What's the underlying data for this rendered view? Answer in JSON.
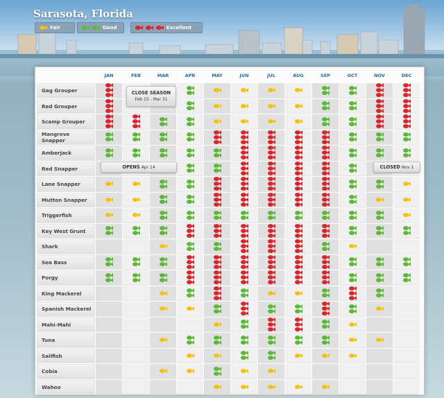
{
  "header": {
    "title": "Sarasota, Florida"
  },
  "legend": [
    {
      "label": "Fair",
      "level": "fair",
      "count": 1
    },
    {
      "label": "Good",
      "level": "good",
      "count": 2
    },
    {
      "label": "Excellent",
      "level": "excellent",
      "count": 3
    }
  ],
  "colors": {
    "fair": "#f4c20d",
    "good": "#5cb835",
    "excellent": "#d8262b",
    "month_header": "#2b6a9a"
  },
  "months": [
    "JAN",
    "FEB",
    "MAR",
    "APR",
    "MAY",
    "JUN",
    "JUL",
    "AUG",
    "SEP",
    "OCT",
    "NOV",
    "DEC"
  ],
  "species": [
    {
      "name": "Gag Grouper",
      "ratings": [
        "excellent",
        "closed",
        "closed",
        "good",
        "fair",
        "fair",
        "fair",
        "fair",
        "good",
        "good",
        "excellent",
        "excellent"
      ]
    },
    {
      "name": "Red Grouper",
      "ratings": [
        "excellent",
        "closed",
        "closed",
        "good",
        "fair",
        "fair",
        "fair",
        "fair",
        "good",
        "good",
        "excellent",
        "excellent"
      ]
    },
    {
      "name": "Scamp Grouper",
      "ratings": [
        "excellent",
        "excellent",
        "good",
        "good",
        "fair",
        "fair",
        "fair",
        "fair",
        "good",
        "good",
        "excellent",
        "excellent"
      ]
    },
    {
      "name": "Mangrove Snapper",
      "ratings": [
        "good",
        "good",
        "good",
        "good",
        "excellent",
        "excellent",
        "excellent",
        "excellent",
        "excellent",
        "good",
        "good",
        "good"
      ]
    },
    {
      "name": "Amberjack",
      "ratings": [
        "good",
        "good",
        "good",
        "good",
        "good",
        "excellent",
        "excellent",
        "excellent",
        "excellent",
        "good",
        "good",
        "good"
      ]
    },
    {
      "name": "Red Snapper",
      "ratings": [
        "closed",
        "closed",
        "closed",
        "good",
        "good",
        "excellent",
        "excellent",
        "excellent",
        "excellent",
        "good",
        "closed",
        "closed"
      ]
    },
    {
      "name": "Lane Snapper",
      "ratings": [
        "fair",
        "fair",
        "good",
        "good",
        "excellent",
        "excellent",
        "excellent",
        "excellent",
        "excellent",
        "good",
        "good",
        "fair"
      ]
    },
    {
      "name": "Mutton Snapper",
      "ratings": [
        "fair",
        "fair",
        "good",
        "good",
        "excellent",
        "excellent",
        "excellent",
        "excellent",
        "excellent",
        "good",
        "fair",
        "fair"
      ]
    },
    {
      "name": "Triggerfish",
      "ratings": [
        "fair",
        "fair",
        "good",
        "good",
        "good",
        "good",
        "good",
        "good",
        "good",
        "good",
        "good",
        "fair"
      ]
    },
    {
      "name": "Key West Grunt",
      "ratings": [
        "good",
        "good",
        "good",
        "excellent",
        "excellent",
        "excellent",
        "excellent",
        "excellent",
        "excellent",
        "good",
        "good",
        "good"
      ]
    },
    {
      "name": "Shark",
      "ratings": [
        "",
        "",
        "fair",
        "good",
        "good",
        "excellent",
        "excellent",
        "excellent",
        "good",
        "fair",
        "",
        ""
      ]
    },
    {
      "name": "Sea Bass",
      "ratings": [
        "good",
        "good",
        "good",
        "excellent",
        "excellent",
        "excellent",
        "excellent",
        "excellent",
        "excellent",
        "good",
        "good",
        "good"
      ]
    },
    {
      "name": "Porgy",
      "ratings": [
        "good",
        "good",
        "good",
        "excellent",
        "excellent",
        "excellent",
        "excellent",
        "excellent",
        "excellent",
        "good",
        "good",
        "good"
      ]
    },
    {
      "name": "King Mackerel",
      "ratings": [
        "",
        "",
        "fair",
        "good",
        "excellent",
        "good",
        "fair",
        "fair",
        "good",
        "excellent",
        "good",
        ""
      ]
    },
    {
      "name": "Spanish Mackerel",
      "ratings": [
        "",
        "",
        "fair",
        "fair",
        "good",
        "excellent",
        "good",
        "good",
        "excellent",
        "good",
        "fair",
        ""
      ]
    },
    {
      "name": "Mahi-Mahi",
      "ratings": [
        "",
        "",
        "",
        "",
        "fair",
        "good",
        "excellent",
        "excellent",
        "good",
        "fair",
        "",
        ""
      ]
    },
    {
      "name": "Tuna",
      "ratings": [
        "",
        "",
        "fair",
        "good",
        "good",
        "good",
        "good",
        "good",
        "good",
        "fair",
        "fair",
        ""
      ]
    },
    {
      "name": "Sailfish",
      "ratings": [
        "",
        "",
        "",
        "fair",
        "fair",
        "good",
        "good",
        "fair",
        "fair",
        "fair",
        "",
        ""
      ]
    },
    {
      "name": "Cobia",
      "ratings": [
        "",
        "",
        "fair",
        "fair",
        "good",
        "fair",
        "fair",
        "",
        "",
        "",
        "",
        ""
      ]
    },
    {
      "name": "Wahoo",
      "ratings": [
        "",
        "",
        "",
        "",
        "fair",
        "fair",
        "fair",
        "fair",
        "fair",
        "",
        "",
        ""
      ]
    }
  ],
  "notes": {
    "close_season": {
      "title": "CLOSE SEASON",
      "dates": "Feb 15 - Mar 31"
    },
    "opens": {
      "title": "OPENS",
      "date": "Apr 14"
    },
    "closed": {
      "title": "CLOSED",
      "date": "Nov 1"
    }
  }
}
